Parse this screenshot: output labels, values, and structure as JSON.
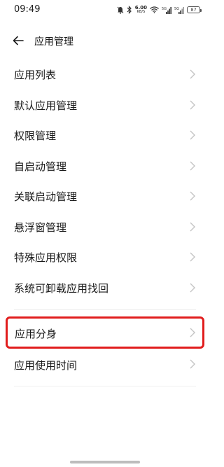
{
  "status_bar": {
    "time": "09:49",
    "net_speed_value": "6.00",
    "net_speed_unit": "KB/S",
    "signal_1": "5G",
    "signal_2": "5G",
    "battery_level": "87",
    "icons": [
      "alarm-icon",
      "bluetooth-icon",
      "wifi-icon",
      "signal-icon",
      "signal-icon",
      "battery-icon"
    ]
  },
  "header": {
    "back_icon": "arrow-left-icon",
    "title": "应用管理"
  },
  "menu": {
    "items": [
      {
        "label": "应用列表"
      },
      {
        "label": "默认应用管理"
      },
      {
        "label": "权限管理"
      },
      {
        "label": "自启动管理"
      },
      {
        "label": "关联启动管理"
      },
      {
        "label": "悬浮窗管理"
      },
      {
        "label": "特殊应用权限"
      },
      {
        "label": "系统可卸载应用找回"
      }
    ],
    "highlighted_item": {
      "label": "应用分身",
      "highlight_color": "#e11d1d"
    },
    "last_item": {
      "label": "应用使用时间"
    },
    "chevron_icon": "chevron-right-icon"
  }
}
